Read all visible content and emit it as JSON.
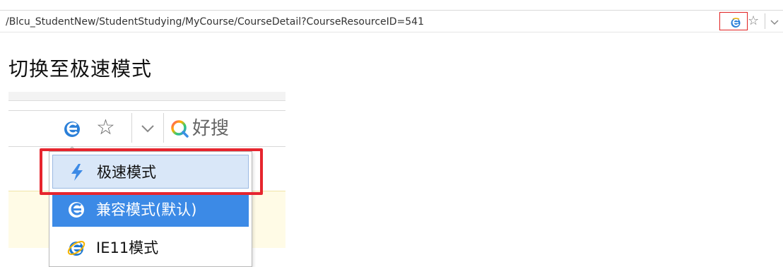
{
  "address_bar": {
    "url": "/Blcu_StudentNew/StudentStudying/MyCourse/CourseDetail?CourseResourceID=541",
    "icons": [
      "ie-mode-icon",
      "favorite-star-icon",
      "chevron-down-icon"
    ]
  },
  "heading": "切换至极速模式",
  "zoomed_toolbar": {
    "search_label": "好搜",
    "icons": [
      "ie-mode-icon",
      "favorite-star-icon",
      "chevron-down-icon",
      "search-icon"
    ]
  },
  "mode_menu": {
    "items": [
      {
        "label": "极速模式",
        "icon": "lightning-icon",
        "state": "highlighted"
      },
      {
        "label": "兼容模式(默认)",
        "icon": "ie-compat-icon",
        "state": "selected"
      },
      {
        "label": "IE11模式",
        "icon": "ie11-icon",
        "state": "normal"
      }
    ]
  },
  "colors": {
    "highlight_box": "#e6252e",
    "selected_item": "#3c8ae6",
    "hover_item": "#d9e7f8",
    "ie_blue": "#2a7fd8"
  }
}
